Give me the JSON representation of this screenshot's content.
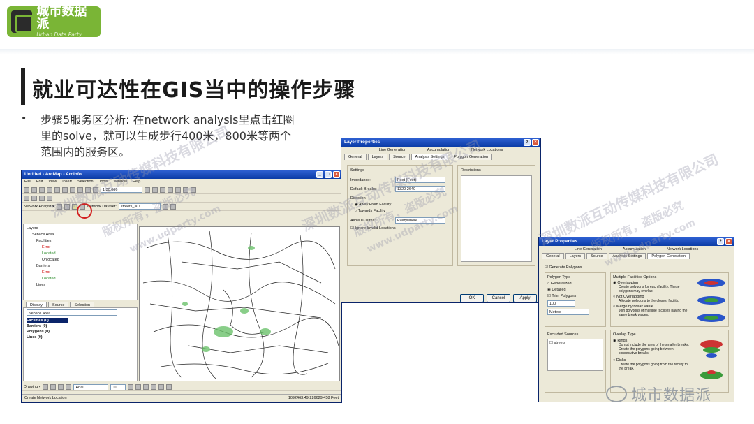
{
  "logo": {
    "cn": "城市数据派",
    "en": "Urban Data Party"
  },
  "slide": {
    "title": "就业可达性在GIS当中的操作步骤",
    "bullet": "•",
    "body": "步骤5服务区分析: 在network analysis里点击红圈里的solve，就可以生成步行400米，800米等两个范围内的服务区。"
  },
  "arcmap": {
    "title": "Untitled - ArcMap - ArcInfo",
    "menu": [
      "File",
      "Edit",
      "View",
      "Insert",
      "Selection",
      "Tools",
      "Window",
      "Help"
    ],
    "scale": "1:30,066",
    "network_analyst": "Network Analyst ▾",
    "network_dataset_label": "Network Dataset:",
    "network_dataset_value": "streets_ND",
    "toc": {
      "layers": "Layers",
      "service_area": "Service Area",
      "facilities": "Facilities",
      "error": "Error",
      "located": "Located",
      "unlocated": "Unlocated",
      "barriers": "Barriers",
      "lines": "Lines"
    },
    "toc_tabs": [
      "Display",
      "Source",
      "Selection"
    ],
    "na_window": {
      "title": "Service Area",
      "items": [
        "Facilities (0)",
        "Barriers (0)",
        "Polygons (0)",
        "Lines (0)"
      ]
    },
    "drawing": "Drawing ▾",
    "font": "Arial",
    "fontsize": "10",
    "status_left": "Create Network Location",
    "status_right": "1092463.49  226629.458 Feet"
  },
  "dialog1": {
    "title": "Layer Properties",
    "tabs_top": [
      "Line Generation",
      "Accumulation",
      "Network Locations"
    ],
    "tabs_bottom": [
      "General",
      "Layers",
      "Source",
      "Analysis Settings",
      "Polygon Generation"
    ],
    "settings_label": "Settings",
    "impedance_label": "Impedance:",
    "impedance_value": "Feet (Feet)",
    "breaks_label": "Default Breaks:",
    "breaks_value": "1320 2640",
    "direction_label": "Direction",
    "away": "Away From Facility",
    "towards": "Towards Facility",
    "uturns_label": "Allow U-Turns:",
    "uturns_value": "Everywhere",
    "ignore": "Ignore Invalid Locations",
    "restrictions": "Restrictions",
    "ok": "OK",
    "cancel": "Cancel",
    "apply": "Apply"
  },
  "dialog2": {
    "title": "Layer Properties",
    "tabs_top": [
      "Line Generation",
      "Accumulation",
      "Network Locations"
    ],
    "tabs_bottom": [
      "General",
      "Layers",
      "Source",
      "Analysis Settings",
      "Polygon Generation"
    ],
    "generate": "Generate Polygons",
    "polygon_type": "Polygon Type",
    "generalized": "Generalized",
    "detailed": "Detailed",
    "trim": "Trim Polygons",
    "trim_value": "100",
    "trim_unit": "Meters",
    "excluded": "Excluded Sources",
    "excluded_item": "streets",
    "multi": "Multiple Facilities Options",
    "overlapping": "Overlapping",
    "overlapping_desc": "Create polygons for each facility. These polygons may overlap.",
    "not_overlapping": "Not Overlapping",
    "not_overlapping_desc": "Allocate polygons to the closest facility.",
    "merge": "Merge by break value",
    "merge_desc": "Join polygons of multiple facilities having the same break values.",
    "overlap_type": "Overlap Type",
    "rings": "Rings",
    "rings_desc": "Do not include the area of the smaller breaks. Create the polygons going between consecutive breaks.",
    "disks": "Disks",
    "disks_desc": "Create the polygons going from the facility to the break."
  },
  "watermark": {
    "a": "深圳数派互动传媒科技有限公司",
    "b": "版权所有，盗版必究",
    "c": "www.udparty.com"
  },
  "wechat": {
    "label": "城市数据派"
  },
  "colors": {
    "logo_green": "#7ab536",
    "xp_blue": "#0b3ca6",
    "red_circle": "#d21f1f"
  }
}
